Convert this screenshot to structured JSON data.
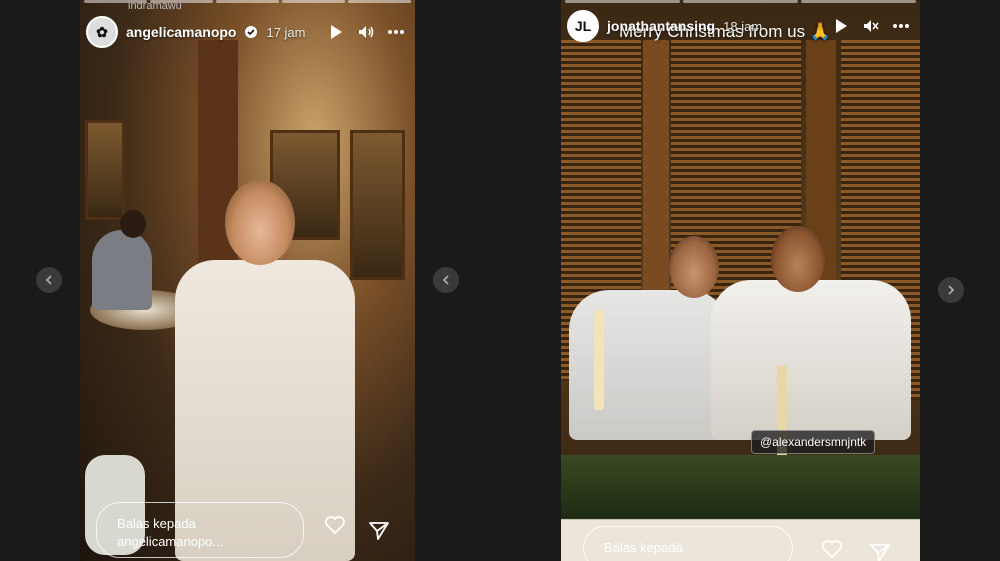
{
  "nav": {
    "left_arrow_icon": "chevron-left-icon",
    "middle_arrow_icon": "chevron-left-icon",
    "right_arrow_icon": "chevron-right-icon"
  },
  "story_left": {
    "top_caption": "indramawu",
    "username": "angelicamanopo",
    "time": "17 jam",
    "reply_placeholder": "Balas kepada angelicamanopo..."
  },
  "story_right": {
    "username": "jonathantansing",
    "time": "18 jam",
    "overlay_text": "Merry Christmas from us 🙏",
    "mention": "@alexandersmnjntk",
    "reply_placeholder": "Balas kepada"
  },
  "colors": {
    "background": "#1a1a1a",
    "verified": "#ffffff"
  }
}
